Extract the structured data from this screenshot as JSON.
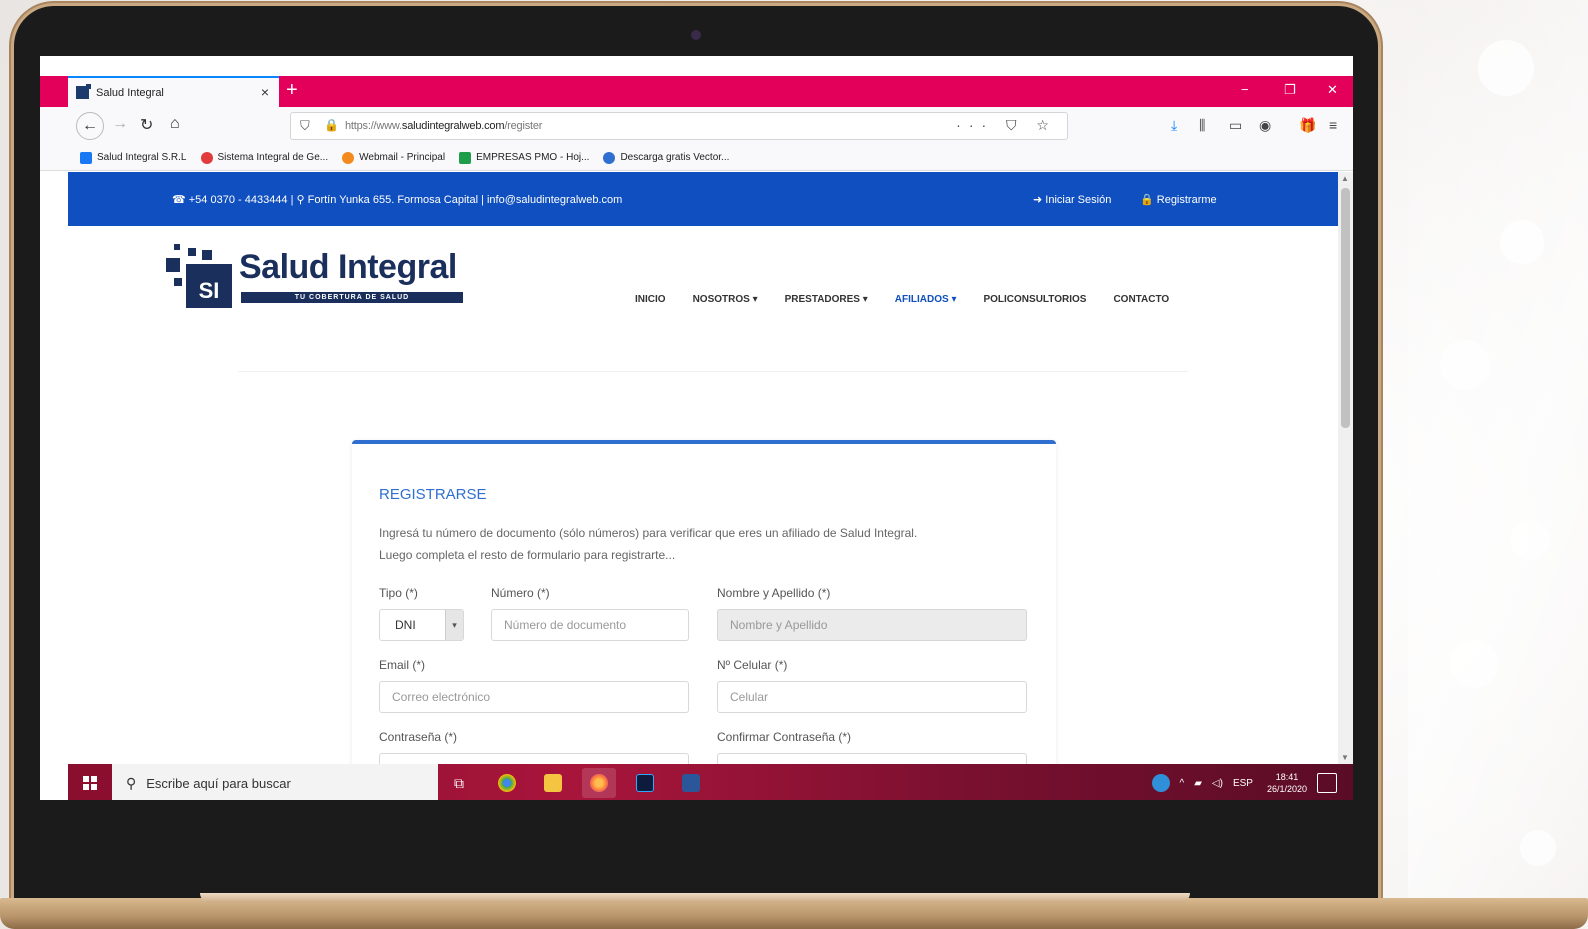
{
  "browser": {
    "tab_title": "Salud Integral",
    "tab_close": "×",
    "new_tab": "+",
    "url_prefix": "https://www.",
    "url_domain": "saludintegralweb.com",
    "url_path": "/register",
    "win_minimize": "−",
    "win_restore": "❐",
    "win_close": "✕",
    "bookmarks": [
      {
        "label": "Salud Integral S.R.L",
        "color": "#1877f2"
      },
      {
        "label": "Sistema Integral de Ge...",
        "color": "#e23b3b"
      },
      {
        "label": "Webmail - Principal",
        "color": "#f28a1e"
      },
      {
        "label": "EMPRESAS PMO - Hoj...",
        "color": "#1e9e4a"
      },
      {
        "label": "Descarga gratis Vector...",
        "color": "#2f6fcf"
      }
    ]
  },
  "site": {
    "contact_line": "☎ +54 0370 - 4433444 | ⚲ Fortín Yunka 655. Formosa Capital | info@saludintegralweb.com",
    "login": "➜ Iniciar Sesión",
    "register": "🔒 Registrarme",
    "logo_name": "Salud Integral",
    "logo_abbr": "SI",
    "logo_tagline": "TU COBERTURA DE SALUD",
    "nav": [
      "INICIO",
      "NOSOTROS ▾",
      "PRESTADORES ▾",
      "AFILIADOS ▾",
      "POLICONSULTORIOS",
      "CONTACTO"
    ]
  },
  "form": {
    "title": "REGISTRARSE",
    "desc_line1": "Ingresá tu número de documento (sólo números) para verificar que eres un afiliado de Salud Integral.",
    "desc_line2": "Luego completa el resto de formulario para registrarte...",
    "tipo_label": "Tipo (*)",
    "tipo_value": "DNI",
    "numero_label": "Número (*)",
    "numero_placeholder": "Número de documento",
    "nombre_label": "Nombre y Apellido (*)",
    "nombre_placeholder": "Nombre y Apellido",
    "email_label": "Email (*)",
    "email_placeholder": "Correo electrónico",
    "celular_label": "Nº Celular (*)",
    "celular_placeholder": "Celular",
    "password_label": "Contraseña (*)",
    "confirm_label": "Confirmar Contraseña (*)"
  },
  "taskbar": {
    "search_placeholder": "Escribe aquí para buscar",
    "language": "ESP",
    "time": "18:41",
    "date": "26/1/2020"
  },
  "colors": {
    "tab_bar": "#e2005a",
    "site_blue": "#0f4fbf",
    "logo_navy": "#1a2f5c",
    "taskbar": "#a8153b"
  }
}
